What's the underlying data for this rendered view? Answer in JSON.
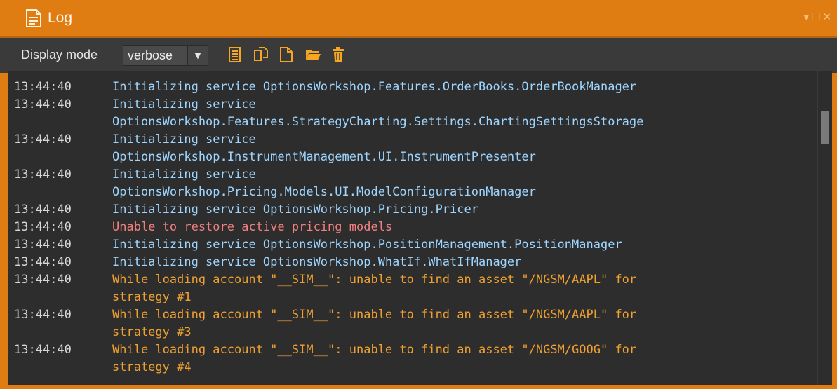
{
  "window": {
    "title": "Log",
    "icon": "log-document-icon",
    "controls": [
      "dropdown-arrow-icon",
      "maximize-icon",
      "close-icon"
    ]
  },
  "toolbar": {
    "display_mode_label": "Display mode",
    "display_mode_value": "verbose",
    "icons": [
      "list-icon",
      "copy-icon",
      "new-file-icon",
      "open-folder-icon",
      "trash-icon"
    ]
  },
  "colors": {
    "frame_accent": "#df7c12",
    "log_background": "#2d2d2d",
    "info_text": "#9ed5ff",
    "error_text": "#f08080",
    "warning_text": "#f0a030"
  },
  "log": {
    "entries": [
      {
        "time": "13:44:40",
        "level": "info",
        "message": "Initializing service OptionsWorkshop.Features.OrderBooks.OrderBookManager"
      },
      {
        "time": "13:44:40",
        "level": "info",
        "message": "Initializing service\nOptionsWorkshop.Features.StrategyCharting.Settings.ChartingSettingsStorage"
      },
      {
        "time": "13:44:40",
        "level": "info",
        "message": "Initializing service\nOptionsWorkshop.InstrumentManagement.UI.InstrumentPresenter"
      },
      {
        "time": "13:44:40",
        "level": "info",
        "message": "Initializing service\nOptionsWorkshop.Pricing.Models.UI.ModelConfigurationManager"
      },
      {
        "time": "13:44:40",
        "level": "info",
        "message": "Initializing service OptionsWorkshop.Pricing.Pricer"
      },
      {
        "time": "13:44:40",
        "level": "error",
        "message": "Unable to restore active pricing models"
      },
      {
        "time": "13:44:40",
        "level": "info",
        "message": "Initializing service OptionsWorkshop.PositionManagement.PositionManager"
      },
      {
        "time": "13:44:40",
        "level": "info",
        "message": "Initializing service OptionsWorkshop.WhatIf.WhatIfManager"
      },
      {
        "time": "13:44:40",
        "level": "warn",
        "message": "While loading account \"__SIM__\": unable to find an asset \"/NGSM/AAPL\" for\nstrategy #1"
      },
      {
        "time": "13:44:40",
        "level": "warn",
        "message": "While loading account \"__SIM__\": unable to find an asset \"/NGSM/AAPL\" for\nstrategy #3"
      },
      {
        "time": "13:44:40",
        "level": "warn",
        "message": "While loading account \"__SIM__\": unable to find an asset \"/NGSM/GOOG\" for\nstrategy #4"
      }
    ]
  }
}
